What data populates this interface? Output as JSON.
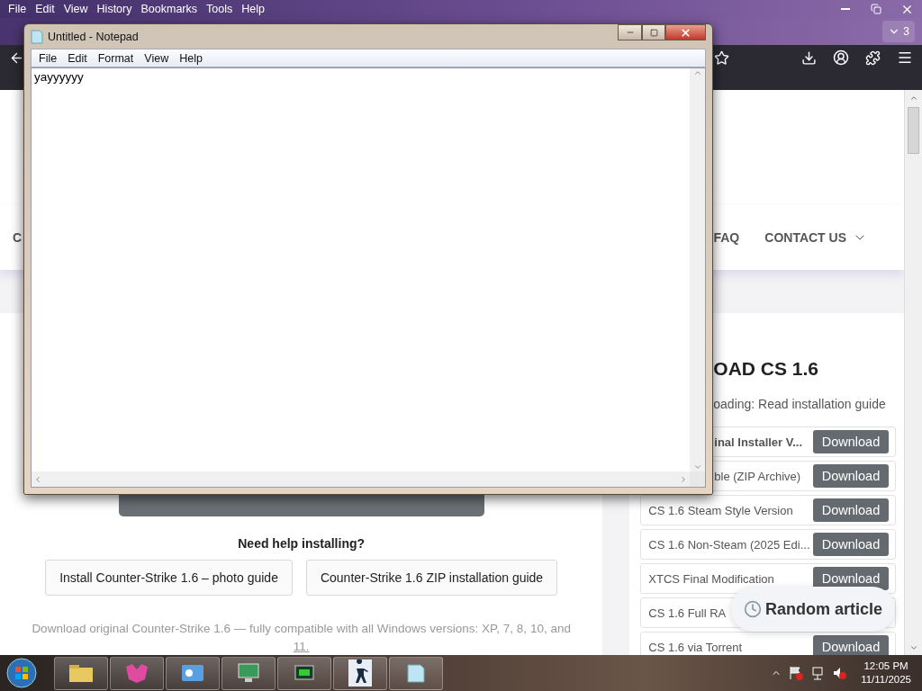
{
  "browser": {
    "menu": [
      "File",
      "Edit",
      "View",
      "History",
      "Bookmarks",
      "Tools",
      "Help"
    ],
    "tab_count": "3"
  },
  "page": {
    "nav": [
      {
        "label": "C",
        "dropdown": false
      },
      {
        "label": "FAQ",
        "dropdown": false
      },
      {
        "label": "CONTACT US",
        "dropdown": true
      }
    ],
    "main": {
      "help_title": "Need help installing?",
      "guides": [
        "Install Counter-Strike 1.6 – photo guide",
        "Counter-Strike 1.6 ZIP installation guide"
      ],
      "footer": "Download original Counter-Strike 1.6 — fully compatible with all Windows versions: XP, 7, 8, 10, and",
      "footer_link": "11."
    },
    "sidebar": {
      "title": "OAD CS 1.6",
      "subtitle": "oading: Read installation guide",
      "downloads": [
        {
          "name": "inal Installer V...",
          "featured": true,
          "button": "Download"
        },
        {
          "name": "ble (ZIP Archive)",
          "featured": false,
          "button": "Download"
        },
        {
          "name": "CS 1.6 Steam Style Version",
          "featured": false,
          "button": "Download"
        },
        {
          "name": "CS 1.6 Non-Steam (2025 Edi...",
          "featured": false,
          "button": "Download"
        },
        {
          "name": "XTCS Final Modification",
          "featured": false,
          "button": "Download"
        },
        {
          "name": "CS 1.6 Full RA",
          "featured": false
        },
        {
          "name": "CS 1.6 via Torrent",
          "featured": false,
          "button": "Download"
        }
      ]
    },
    "random_article": "Random article"
  },
  "notepad": {
    "title": "Untitled - Notepad",
    "menu": [
      "File",
      "Edit",
      "Format",
      "View",
      "Help"
    ],
    "text": "yayyyyyy"
  },
  "taskbar": {
    "time": "12:05 PM",
    "date": "11/11/2025"
  }
}
